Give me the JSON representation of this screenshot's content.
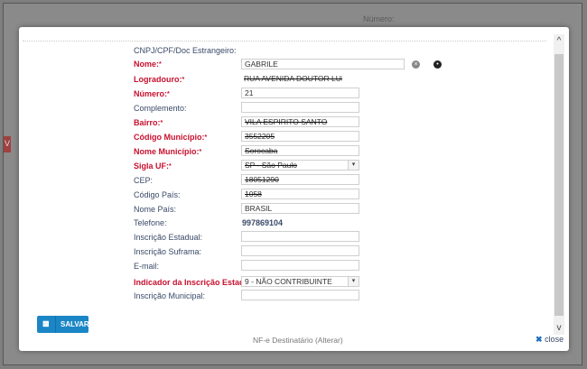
{
  "background": {
    "numero_label": "Número:",
    "tab_label": "V"
  },
  "modal": {
    "header_label": "CNPJ/CPF/Doc Estrangeiro:",
    "fields": {
      "nome": {
        "label": "Nome:",
        "value": "GABRILE"
      },
      "logradouro": {
        "label": "Logradouro:",
        "value": "RUA AVENIDA DOUTOR LUIZ MES"
      },
      "numero": {
        "label": "Número:",
        "value": "21"
      },
      "complemento": {
        "label": "Complemento:",
        "value": ""
      },
      "bairro": {
        "label": "Bairro:",
        "value": "VILA ESPIRITO SANTO"
      },
      "codigo_municipio": {
        "label": "Código Município:",
        "value": "3552205"
      },
      "nome_municipio": {
        "label": "Nome Município:",
        "value": "Sorocaba"
      },
      "sigla_uf": {
        "label": "Sigla UF:",
        "value": "SP - São Paulo"
      },
      "cep": {
        "label": "CEP:",
        "value": "18051290"
      },
      "codigo_pais": {
        "label": "Código País:",
        "value": "1058"
      },
      "nome_pais": {
        "label": "Nome País:",
        "value": "BRASIL"
      },
      "telefone": {
        "label": "Telefone:",
        "value": "997869104"
      },
      "inscricao_estadual": {
        "label": "Inscrição Estadual:",
        "value": ""
      },
      "inscricao_suframa": {
        "label": "Inscrição Suframa:",
        "value": ""
      },
      "email": {
        "label": "E-mail:",
        "value": ""
      },
      "indicador_ie": {
        "label": "Indicador da Inscrição Estadual:",
        "value": "9 - NÃO CONTRIBUINTE"
      },
      "inscricao_municipal": {
        "label": "Inscrição Municipal:",
        "value": ""
      }
    },
    "save_label": "SALVAR",
    "footer_title": "NF-e Destinatário (Alterar)",
    "close_label": "close"
  },
  "colors": {
    "required_label": "#c8102e",
    "label": "#3a4a68",
    "primary_button": "#1b86c6"
  }
}
